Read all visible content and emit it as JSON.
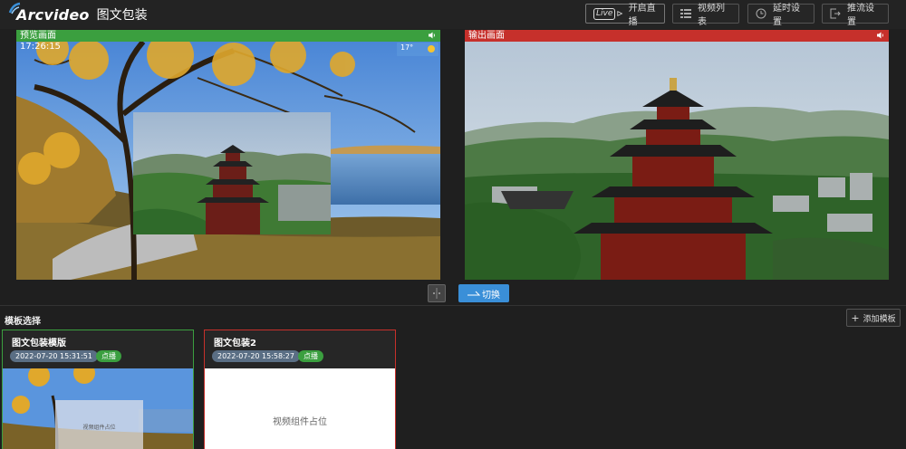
{
  "header": {
    "logo_text": "Arcvideo",
    "page_name": "图文包装",
    "live_badge": "Live",
    "start_live": "开启直播",
    "video_list": "视频列表",
    "delay_settings": "延时设置",
    "push_settings": "推流设置"
  },
  "preview": {
    "label": "预览画面",
    "clock": "17:26:15",
    "weather": "17°"
  },
  "output": {
    "label": "输出画面"
  },
  "controls": {
    "switch_label": "切换"
  },
  "templates": {
    "title": "模板选择",
    "add_label": "添加模板",
    "items": [
      {
        "name": "图文包装模版",
        "time": "2022-07-20 15:31:51",
        "tag": "点播",
        "overlay_text": "视频组件占位"
      },
      {
        "name": "图文包装2",
        "time": "2022-07-20 15:58:27",
        "tag": "点播",
        "placeholder": "视频组件占位"
      }
    ]
  },
  "colors": {
    "preview_accent": "#3b9f3f",
    "output_accent": "#c6302b",
    "primary_button": "#3a8fd8"
  }
}
